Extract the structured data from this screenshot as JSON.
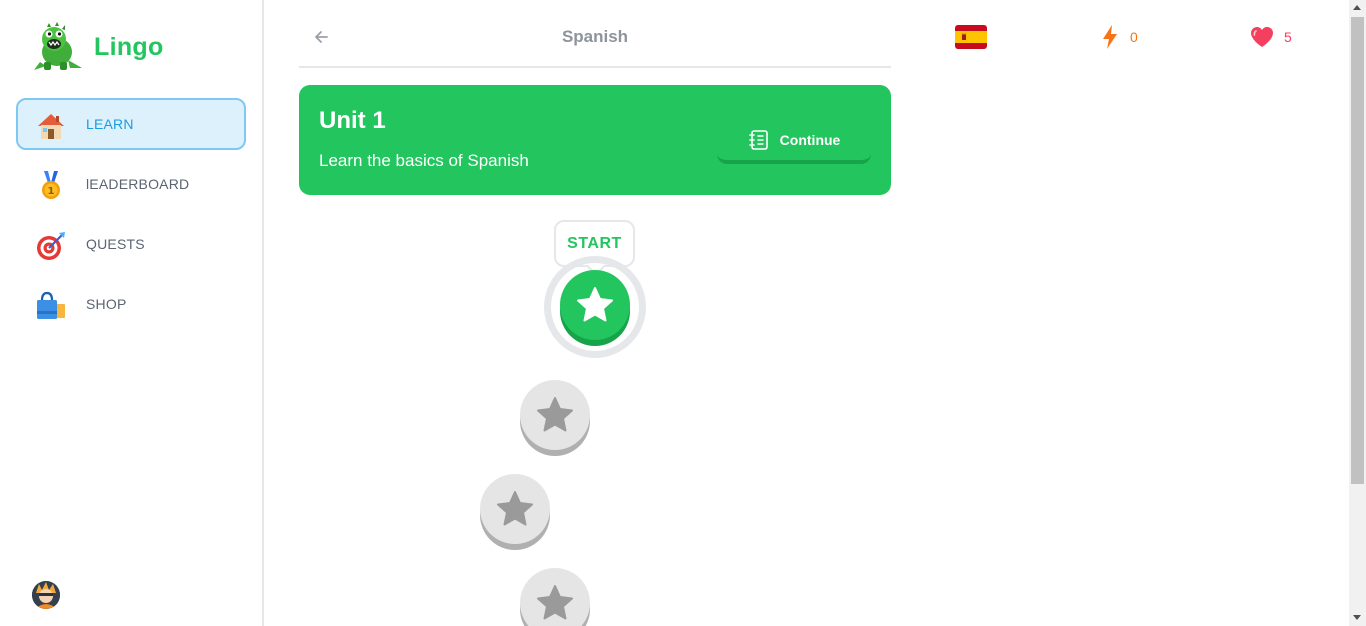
{
  "sidebar": {
    "brand": "Lingo",
    "items": [
      {
        "label": "LEARN",
        "icon": "house-icon",
        "active": true
      },
      {
        "label": "lEADERBOARD",
        "icon": "medal-icon",
        "active": false
      },
      {
        "label": "QUESTS",
        "icon": "target-icon",
        "active": false
      },
      {
        "label": "SHOP",
        "icon": "shopping-bag-icon",
        "active": false
      }
    ]
  },
  "header": {
    "title": "Spanish",
    "back_icon": "arrow-left-icon"
  },
  "stats": {
    "flag": "spain-flag-icon",
    "points": "0",
    "hearts": "5"
  },
  "unit": {
    "title": "Unit 1",
    "description": "Learn the basics of Spanish",
    "continue_label": "Continue",
    "continue_icon": "notebook-icon"
  },
  "path": {
    "start_label": "START",
    "lessons": [
      {
        "status": "active",
        "icon": "star-icon"
      },
      {
        "status": "locked",
        "icon": "star-icon"
      },
      {
        "status": "locked",
        "icon": "star-icon"
      },
      {
        "status": "locked",
        "icon": "star-icon"
      }
    ]
  },
  "colors": {
    "brand": "#22c55e",
    "active_nav_bg": "#ddf1fd",
    "active_nav_text": "#1c9ce0",
    "points": "#f97316",
    "hearts": "#f43f5e"
  }
}
